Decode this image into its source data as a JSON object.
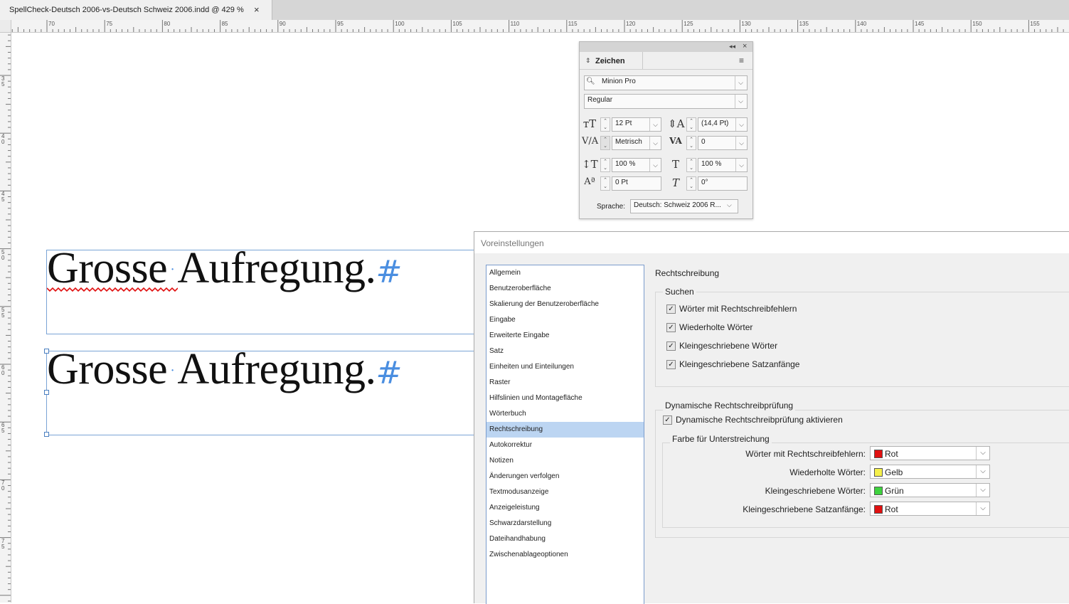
{
  "document": {
    "tab_title": "SpellCheck-Deutsch 2006-vs-Deutsch Schweiz 2006.indd @ 429 %",
    "close_glyph": "×"
  },
  "ruler": {
    "h_labels": [
      "70",
      "75",
      "80",
      "85",
      "90",
      "95",
      "100",
      "105",
      "110",
      "115",
      "120",
      "125",
      "130",
      "135",
      "140",
      "145",
      "150",
      "155"
    ],
    "v_labels": [
      "35",
      "40",
      "45",
      "50",
      "55",
      "60",
      "65",
      "70",
      "75"
    ]
  },
  "frames": [
    {
      "word1": "Grosse",
      "word2": "Aufregung.",
      "space_marker": "·",
      "end_marker": "#",
      "misspelled": true
    },
    {
      "word1": "Grosse",
      "word2": "Aufregung.",
      "space_marker": "·",
      "end_marker": "#",
      "misspelled": false
    }
  ],
  "char_panel": {
    "title": "Zeichen",
    "font_family": "Minion Pro",
    "font_style": "Regular",
    "size": "12 Pt",
    "leading": "(14,4 Pt)",
    "kerning": "Metrisch",
    "tracking": "0",
    "vertical_scale": "100 %",
    "horizontal_scale": "100 %",
    "baseline_shift": "0 Pt",
    "skew": "0°",
    "language_label": "Sprache:",
    "language": "Deutsch: Schweiz 2006 R..."
  },
  "prefs": {
    "title": "Voreinstellungen",
    "categories": [
      "Allgemein",
      "Benutzeroberfläche",
      "Skalierung der Benutzeroberfläche",
      "Eingabe",
      "Erweiterte Eingabe",
      "Satz",
      "Einheiten und Einteilungen",
      "Raster",
      "Hilfslinien und Montagefläche",
      "Wörterbuch",
      "Rechtschreibung",
      "Autokorrektur",
      "Notizen",
      "Änderungen verfolgen",
      "Textmodusanzeige",
      "Anzeigeleistung",
      "Schwarzdarstellung",
      "Dateihandhabung",
      "Zwischenablageoptionen"
    ],
    "selected_index": 10,
    "section_title": "Rechtschreibung",
    "search_group": {
      "label": "Suchen",
      "options": [
        "Wörter mit Rechtschreibfehlern",
        "Wiederholte Wörter",
        "Kleingeschriebene Wörter",
        "Kleingeschriebene Satzanfänge"
      ]
    },
    "dynamic_group": {
      "label": "Dynamische Rechtschreibprüfung",
      "enable_label": "Dynamische Rechtschreibprüfung aktivieren",
      "color_group_label": "Farbe für Unterstreichung",
      "rows": [
        {
          "label": "Wörter mit Rechtschreibfehlern:",
          "value": "Rot",
          "color": "#e01010"
        },
        {
          "label": "Wiederholte Wörter:",
          "value": "Gelb",
          "color": "#f5f04a"
        },
        {
          "label": "Kleingeschriebene Wörter:",
          "value": "Grün",
          "color": "#3ed23e"
        },
        {
          "label": "Kleingeschriebene Satzanfänge:",
          "value": "Rot",
          "color": "#e01010"
        }
      ]
    },
    "checkmark": "✓"
  }
}
